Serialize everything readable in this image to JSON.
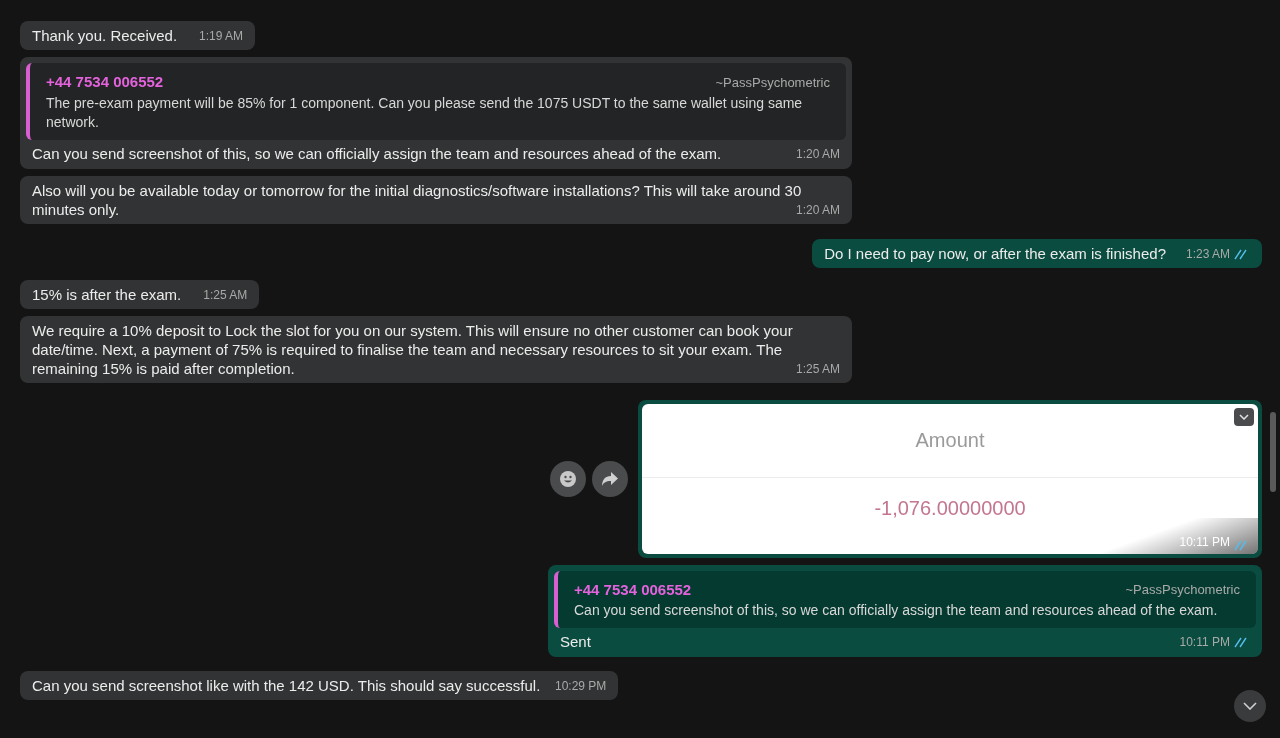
{
  "messages": [
    {
      "kind": "text",
      "outgoing": false,
      "text": "Thank you. Received.",
      "time": "1:19 AM"
    },
    {
      "kind": "quote",
      "outgoing": false,
      "quote": {
        "author": "+44 7534 006552",
        "name": "~PassPsychometric",
        "text": "The pre-exam payment will be 85% for 1 component. Can you please send the 1075 USDT to the same wallet using same network."
      },
      "text": "Can you send screenshot of this, so we can officially assign the team and resources ahead of the exam.",
      "time": "1:20 AM"
    },
    {
      "kind": "text",
      "outgoing": false,
      "text": "Also will you be available today or tomorrow for the initial diagnostics/software installations? This will take around 30 minutes only.",
      "time": "1:20 AM"
    },
    {
      "kind": "text",
      "outgoing": true,
      "text": "Do I need to pay now, or after the exam is finished?",
      "time": "1:23 AM",
      "read": true
    },
    {
      "kind": "text",
      "outgoing": false,
      "text": "15% is after the exam.",
      "time": "1:25 AM"
    },
    {
      "kind": "text",
      "outgoing": false,
      "text": "We require a 10% deposit to Lock the slot for you on our system. This will ensure no other customer can book your date/time. Next, a payment of 75% is required to finalise the team and necessary resources to sit your exam. The remaining 15% is paid after completion.",
      "time": "1:25 AM"
    },
    {
      "kind": "image",
      "outgoing": true,
      "image": {
        "label": "Amount",
        "value": "-1,076.00000000"
      },
      "time": "10:11 PM",
      "read": true
    },
    {
      "kind": "quote",
      "outgoing": true,
      "quote": {
        "author": "+44 7534 006552",
        "name": "~PassPsychometric",
        "text": "Can you send screenshot of this, so we can officially assign the team and resources ahead of the exam."
      },
      "text": "Sent",
      "time": "10:11 PM",
      "read": true
    },
    {
      "kind": "text",
      "outgoing": false,
      "text": "Can you send screenshot like with the 142 USD. This should say successful.",
      "time": "10:29 PM"
    }
  ]
}
